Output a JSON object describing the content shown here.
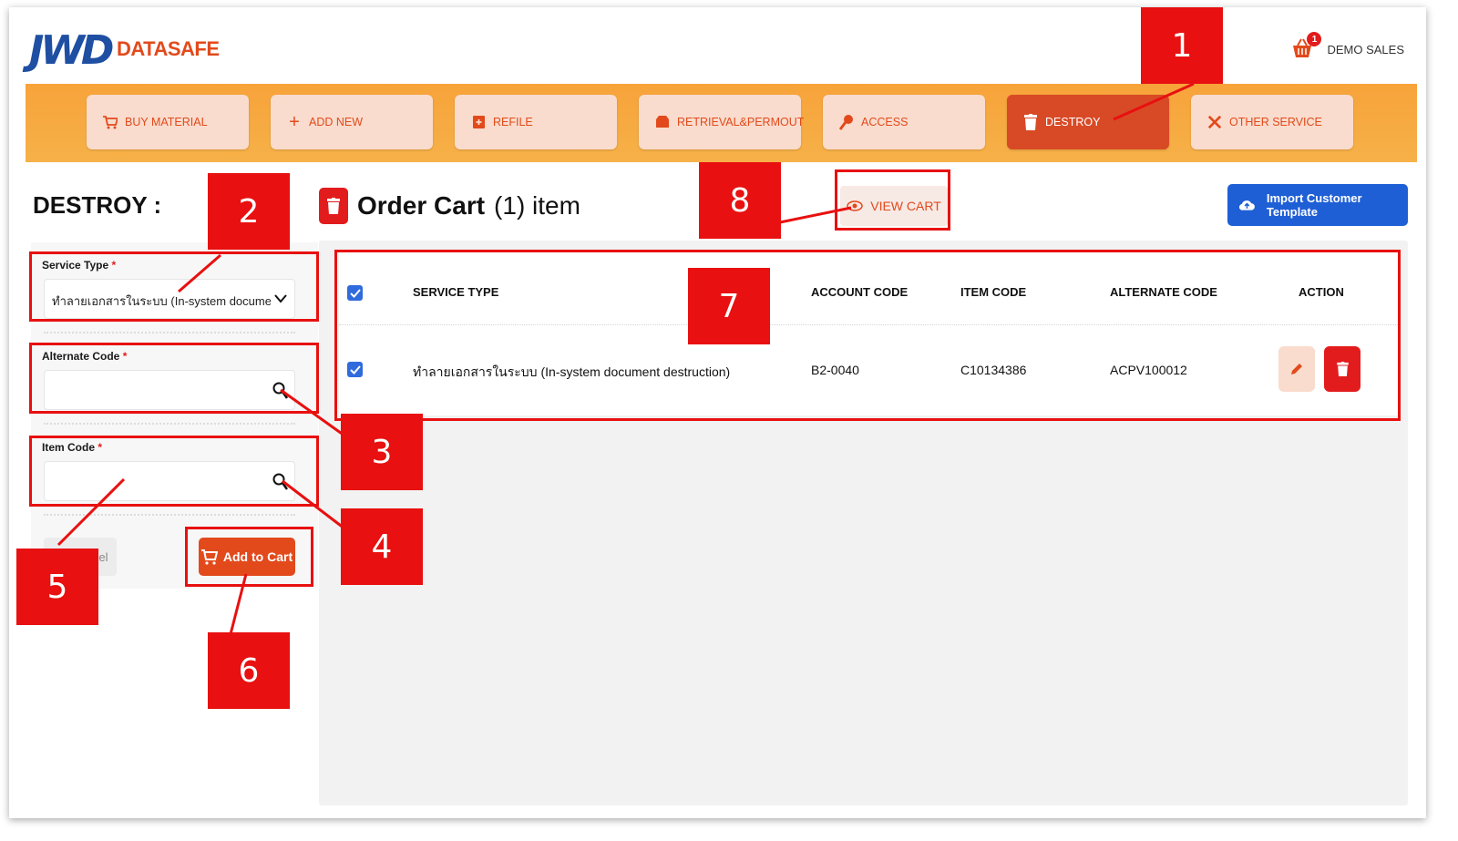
{
  "header": {
    "logo_mark": "JWD",
    "logo_text": "DATASAFE",
    "cart_badge": "1",
    "user_name": "DEMO SALES"
  },
  "nav": {
    "items": [
      {
        "label": "BUY MATERIAL",
        "icon": "cart-icon"
      },
      {
        "label": "ADD NEW",
        "icon": "plus-icon"
      },
      {
        "label": "REFILE",
        "icon": "file-plus-icon"
      },
      {
        "label": "RETRIEVAL&PERMOUT",
        "icon": "box-icon"
      },
      {
        "label": "ACCESS",
        "icon": "key-icon"
      },
      {
        "label": "DESTROY",
        "icon": "trash-icon",
        "active": true
      },
      {
        "label": "OTHER SERVICE",
        "icon": "tools-icon"
      }
    ]
  },
  "form": {
    "title": "DESTROY :",
    "service_type_label": "Service Type",
    "service_type_value": "ทำลายเอกสารในระบบ (In-system document",
    "alternate_code_label": "Alternate Code",
    "alternate_code_value": "",
    "item_code_label": "Item Code",
    "item_code_value": "",
    "required_mark": "*",
    "cancel_label": "Cancel",
    "add_to_cart_label": "Add to Cart"
  },
  "cart": {
    "title": "Order Cart",
    "count_text": "(1) item",
    "view_cart_label": "VIEW CART",
    "import_label": "Import Customer Template",
    "columns": [
      "SERVICE TYPE",
      "ACCOUNT CODE",
      "ITEM CODE",
      "ALTERNATE CODE",
      "ACTION"
    ],
    "rows": [
      {
        "service_type": "ทำลายเอกสารในระบบ (In-system document destruction)",
        "account_code": "B2-0040",
        "item_code": "C10134386",
        "alternate_code": "ACPV100012",
        "checked": true
      }
    ],
    "all_checked": true
  },
  "annotations": [
    "1",
    "2",
    "3",
    "4",
    "5",
    "6",
    "7",
    "8"
  ],
  "colors": {
    "brand_orange": "#e24a1c",
    "nav_bar": "#f7a33a",
    "nav_item": "#f9dccd",
    "annotation_red": "#e81010",
    "import_blue": "#1f5fd6",
    "logo_blue": "#1f4fa3"
  }
}
